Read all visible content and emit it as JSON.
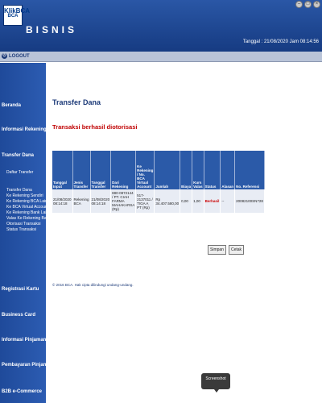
{
  "header": {
    "logo_line1": "KlikBCA",
    "logo_line2": "BCA",
    "app_title": "BISNIS",
    "date_text": "Tanggal : 21/08/2020 Jam 08:14:56",
    "icons": [
      "minimize-icon",
      "restore-icon",
      "close-icon"
    ]
  },
  "logout_label": "LOGOUT",
  "sidebar": {
    "items": [
      {
        "label": "Beranda"
      },
      {
        "label": "Informasi Rekening"
      },
      {
        "label": "Transfer Dana"
      },
      {
        "label": "Registrasi Kartu"
      },
      {
        "label": "Business Card"
      },
      {
        "label": "Informasi Pinjaman"
      },
      {
        "label": "Pembayaran Pinjaman"
      },
      {
        "label": "B2B e-Commerce"
      }
    ],
    "sub_items": [
      "Daftar Transfer",
      "Transfer Dana",
      "Ke Rekening Sendiri",
      "Ke Rekening BCA Lainnya",
      "Ke BCA Virtual Account",
      "Ke Rekening Bank Lain",
      "Valas Ke Rekening Bank",
      "Otorisasi Transaksi",
      "Status Transaksi"
    ]
  },
  "main": {
    "title": "Transfer Dana",
    "success_message": "Transaksi berhasil diotorisasi",
    "table": {
      "headers": [
        "Tanggal Input",
        "Jenis Transfer",
        "Tanggal Transfer",
        "Dari Rekening",
        "Ke Rekening / No. BCA Virtual Account",
        "Jumlah",
        "Biaya",
        "Kurs Valas",
        "Status",
        "Alasan",
        "No. Referensi"
      ],
      "row": [
        "21/08/2020 08:14:18",
        "Rekening BCA",
        "21/08/2020 08:14:18",
        "880-0872144 / PT. CIAH FARMA MAHAKARSA (Rp)",
        "517-2137011 / TIGA A PT (Rp)",
        "Rp 34.407.580,00",
        "0,00",
        "1,00",
        "Berhasil",
        "--",
        "20082100SN728"
      ]
    },
    "buttons": {
      "save": "Simpan",
      "print": "Cetak"
    },
    "copyright": "© 2016 BCA. Hak cipta dilindungi undang-undang."
  },
  "screenshot_label": "Screenshot",
  "colors": {
    "header": "#1f4a9a",
    "sidebar": "#2a5aad",
    "table_header": "#2b5aa8",
    "status_error": "#cc0000"
  }
}
